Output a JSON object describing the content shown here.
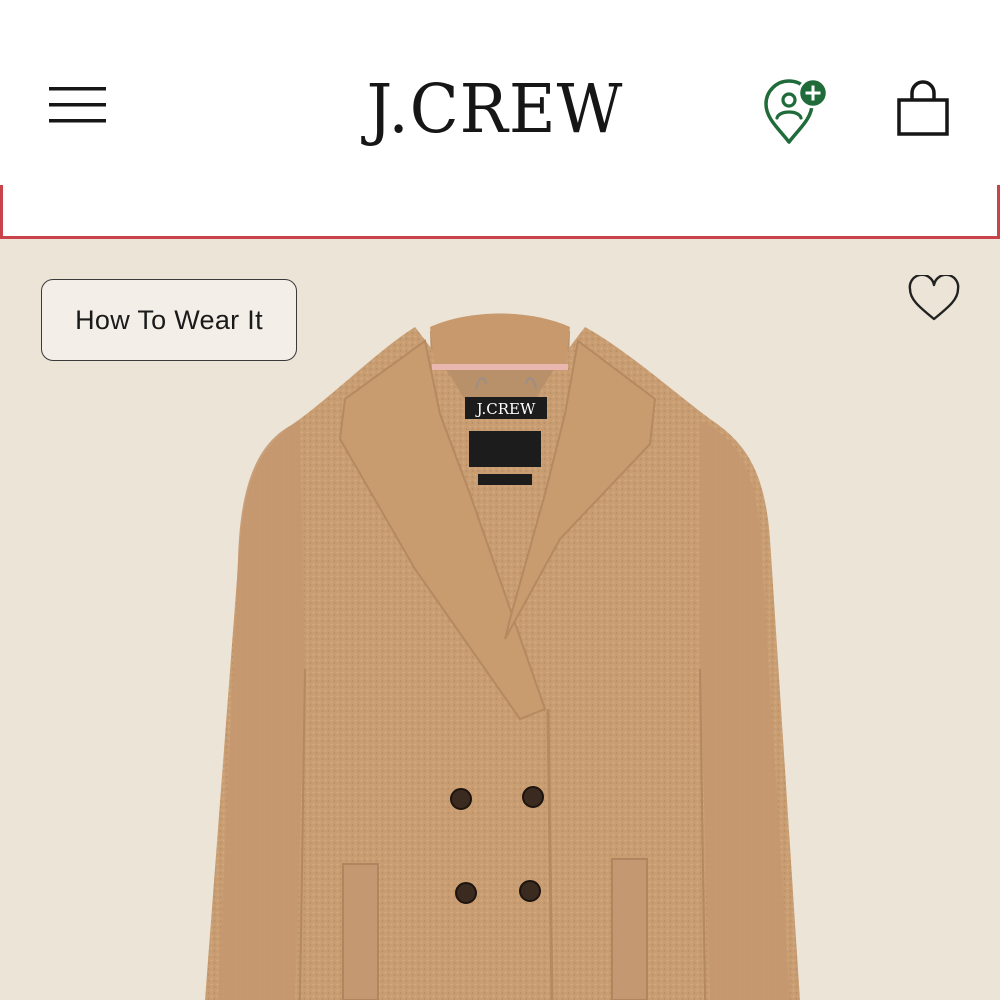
{
  "header": {
    "brand": "J.CREW",
    "menu_icon": "hamburger-menu-icon",
    "location_icon": "location-person-add-icon",
    "bag_icon": "shopping-bag-icon"
  },
  "product": {
    "how_to_wear_label": "How To Wear It",
    "favorite_icon": "heart-outline-icon",
    "image": "camel-double-breasted-wool-coat",
    "label_brand": "J.CREW"
  },
  "colors": {
    "product_background": "#ece4d7",
    "banner_border": "#c9444a",
    "location_accent": "#1f6b3a",
    "coat": "#c79a70"
  }
}
